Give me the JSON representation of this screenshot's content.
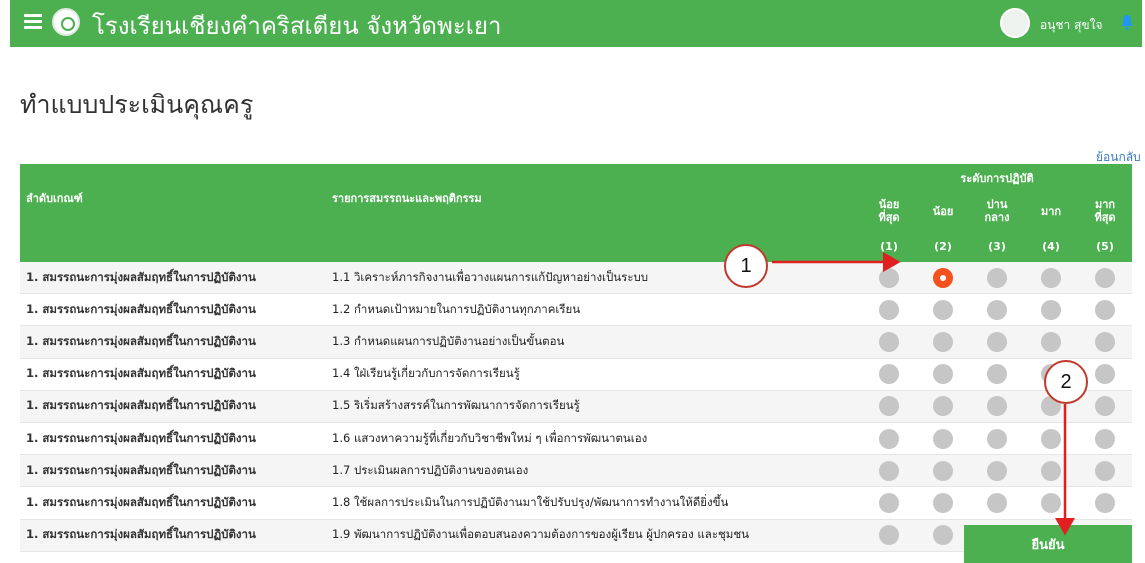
{
  "header": {
    "school_name": "โรงเรียนเชียงคำคริสเตียน จังหวัดพะเยา",
    "user_name": "อนุชา สุขใจ"
  },
  "page": {
    "title": "ทำแบบประเมินคุณครู",
    "back_link": "ย้อนกลับ"
  },
  "table": {
    "headers": {
      "criteria": "ลำดับเกณฑ์",
      "items": "รายการสมรรถนะและพฤติกรรม",
      "level_group": "ระดับการปฏิบัติ",
      "levels": [
        {
          "label": "น้อย\nที่สุด",
          "num": "(1)"
        },
        {
          "label": "น้อย",
          "num": "(2)"
        },
        {
          "label": "ปาน\nกลาง",
          "num": "(3)"
        },
        {
          "label": "มาก",
          "num": "(4)"
        },
        {
          "label": "มาก\nที่สุด",
          "num": "(5)"
        }
      ]
    },
    "rows": [
      {
        "criterion": "1. สมรรถนะการมุ่งผลสัมฤทธิ์ในการปฏิบัติงาน",
        "item": "1.1 วิเคราะห์ภารกิจงานเพื่อวางแผนการแก้ปัญหาอย่างเป็นระบบ",
        "selected": 2
      },
      {
        "criterion": "1. สมรรถนะการมุ่งผลสัมฤทธิ์ในการปฏิบัติงาน",
        "item": "1.2 กำหนดเป้าหมายในการปฏิบัติงานทุกภาคเรียน",
        "selected": 0
      },
      {
        "criterion": "1. สมรรถนะการมุ่งผลสัมฤทธิ์ในการปฏิบัติงาน",
        "item": "1.3 กำหนดแผนการปฏิบัติงานอย่างเป็นขั้นตอน",
        "selected": 0
      },
      {
        "criterion": "1. สมรรถนะการมุ่งผลสัมฤทธิ์ในการปฏิบัติงาน",
        "item": "1.4 ใฝ่เรียนรู้เกี่ยวกับการจัดการเรียนรู้",
        "selected": 0
      },
      {
        "criterion": "1. สมรรถนะการมุ่งผลสัมฤทธิ์ในการปฏิบัติงาน",
        "item": "1.5 ริเริ่มสร้างสรรค์ในการพัฒนาการจัดการเรียนรู้",
        "selected": 0
      },
      {
        "criterion": "1. สมรรถนะการมุ่งผลสัมฤทธิ์ในการปฏิบัติงาน",
        "item": "1.6 แสวงหาความรู้ที่เกี่ยวกับวิชาชีพใหม่ ๆ เพื่อการพัฒนาตนเอง",
        "selected": 0
      },
      {
        "criterion": "1. สมรรถนะการมุ่งผลสัมฤทธิ์ในการปฏิบัติงาน",
        "item": "1.7 ประเมินผลการปฏิบัติงานของตนเอง",
        "selected": 0
      },
      {
        "criterion": "1. สมรรถนะการมุ่งผลสัมฤทธิ์ในการปฏิบัติงาน",
        "item": "1.8 ใช้ผลการประเมินในการปฏิบัติงานมาใช้ปรับปรุง/พัฒนาการทำงานให้ดียิ่งขึ้น",
        "selected": 0
      },
      {
        "criterion": "1. สมรรถนะการมุ่งผลสัมฤทธิ์ในการปฏิบัติงาน",
        "item": "1.9 พัฒนาการปฏิบัติงานเพื่อตอบสนองความต้องการของผู้เรียน ผู้ปกครอง และชุมชน",
        "selected": 0
      }
    ]
  },
  "confirm_label": "ยืนยัน",
  "callouts": [
    "1",
    "2"
  ],
  "colors": {
    "primary": "#4caf50",
    "selected_radio": "#f4511e",
    "radio": "#c6c6c6",
    "callout_arrow": "#e02020"
  }
}
